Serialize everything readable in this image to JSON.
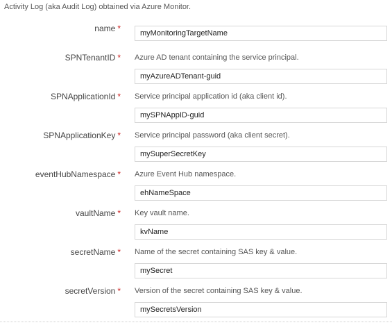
{
  "intro": "Activity Log (aka Audit Log) obtained via Azure Monitor.",
  "required_marker": "*",
  "fields": [
    {
      "label": "name",
      "description": "",
      "value": "myMonitoringTargetName"
    },
    {
      "label": "SPNTenantID",
      "description": "Azure AD tenant containing the service principal.",
      "value": "myAzureADTenant-guid"
    },
    {
      "label": "SPNApplicationId",
      "description": "Service principal application id (aka client id).",
      "value": "mySPNAppID-guid"
    },
    {
      "label": "SPNApplicationKey",
      "description": "Service principal password (aka client secret).",
      "value": "mySuperSecretKey"
    },
    {
      "label": "eventHubNamespace",
      "description": "Azure Event Hub namespace.",
      "value": "ehNameSpace"
    },
    {
      "label": "vaultName",
      "description": "Key vault name.",
      "value": "kvName"
    },
    {
      "label": "secretName",
      "description": "Name of the secret containing SAS key & value.",
      "value": "mySecret"
    },
    {
      "label": "secretVersion",
      "description": "Version of the secret containing SAS key & value.",
      "value": "mySecretsVersion"
    }
  ]
}
